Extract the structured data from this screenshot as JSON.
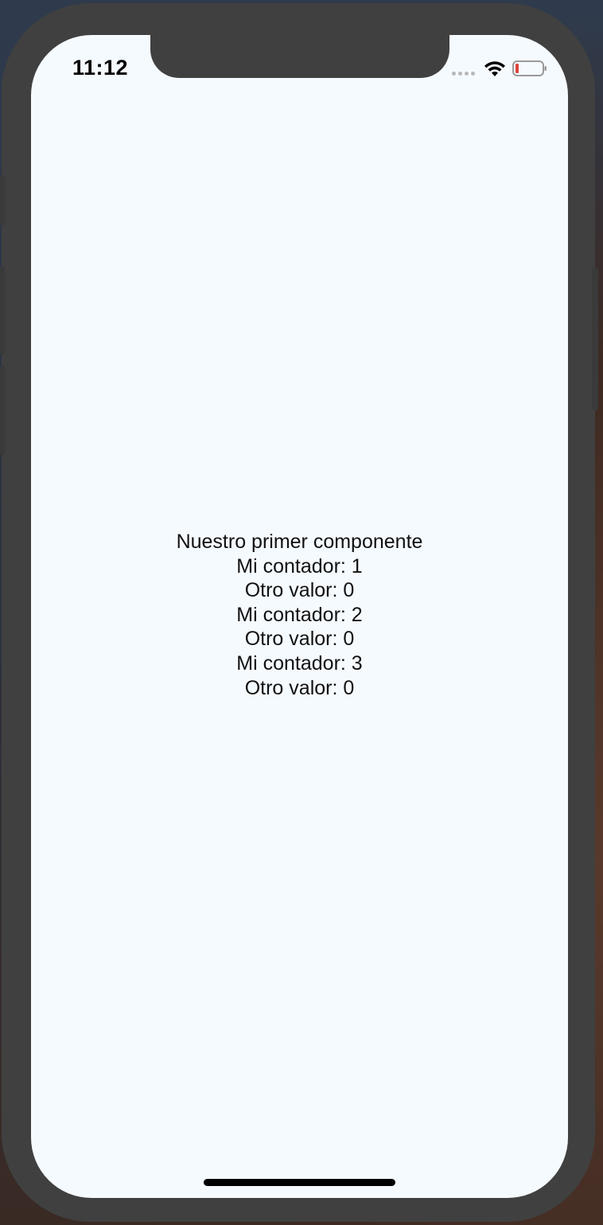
{
  "status_bar": {
    "time": "11:12",
    "wifi_icon": "wifi-icon",
    "battery_icon": "battery-low-icon",
    "battery_color": "#e0443a"
  },
  "app": {
    "background_color": "#f5faff",
    "lines": [
      "Nuestro primer componente",
      "Mi contador: 1",
      "Otro valor: 0",
      "Mi contador: 2",
      "Otro valor: 0",
      "Mi contador: 3",
      "Otro valor: 0"
    ]
  }
}
